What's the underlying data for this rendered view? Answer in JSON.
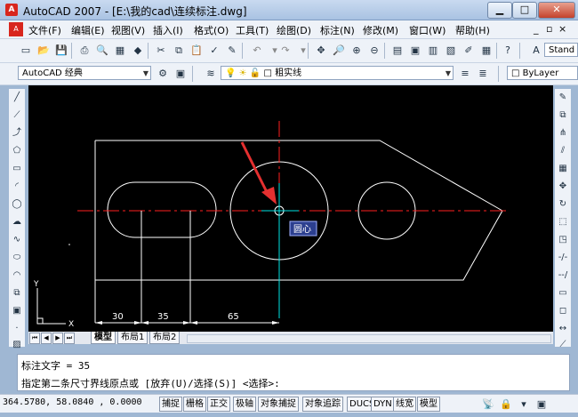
{
  "window": {
    "title": "AutoCAD 2007 - [E:\\我的cad\\连续标注.dwg]",
    "app_icon": "A"
  },
  "menu": [
    {
      "label": "文件(F)"
    },
    {
      "label": "编辑(E)"
    },
    {
      "label": "视图(V)"
    },
    {
      "label": "插入(I)"
    },
    {
      "label": "格式(O)"
    },
    {
      "label": "工具(T)"
    },
    {
      "label": "绘图(D)"
    },
    {
      "label": "标注(N)"
    },
    {
      "label": "修改(M)"
    },
    {
      "label": "窗口(W)"
    },
    {
      "label": "帮助(H)"
    }
  ],
  "toolbar": {
    "style_box": "Stand"
  },
  "workspace": {
    "value": "AutoCAD 经典"
  },
  "layer": {
    "value": "粗实线"
  },
  "bylayer": {
    "value": "ByLayer"
  },
  "drawing": {
    "tooltip": "圆心",
    "dims": [
      "30",
      "35",
      "65"
    ],
    "ucs_x": "X",
    "ucs_y": "Y"
  },
  "tabs": {
    "model": "模型",
    "layout1": "布局1",
    "layout2": "布局2"
  },
  "command": {
    "line1": "标注文字 = 35",
    "line2": "指定第二条尺寸界线原点或 [放弃(U)/选择(S)] <选择>:"
  },
  "status": {
    "coords": "364.5780, 58.0840 , 0.0000",
    "buttons": [
      {
        "label": "捕捉"
      },
      {
        "label": "栅格"
      },
      {
        "label": "正交"
      },
      {
        "label": "极轴"
      },
      {
        "label": "对象捕捉"
      },
      {
        "label": "对象追踪"
      },
      {
        "label": "DUCS"
      },
      {
        "label": "DYN"
      },
      {
        "label": "线宽"
      },
      {
        "label": "模型"
      }
    ]
  },
  "colors": {
    "canvas": "#000000",
    "geometry": "#ffffff",
    "centerline": "#ff2020",
    "tracking": "#00e5e5",
    "arrow": "#e53030"
  }
}
